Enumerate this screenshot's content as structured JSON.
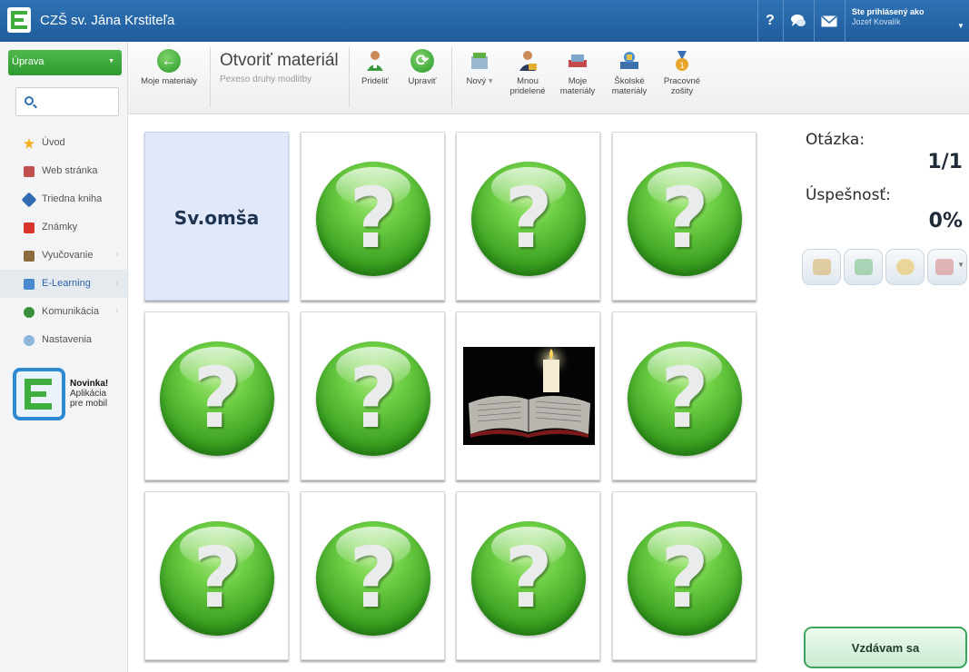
{
  "app": {
    "title": "CZŠ sv. Jána Krstiteľa"
  },
  "topbar": {
    "help_icon": "question-icon",
    "chat_icon": "chat-icon",
    "mail_icon": "mail-icon",
    "user_label": "Ste prihlásený ako",
    "user_name": "Jozef Kovalík"
  },
  "sidebar": {
    "mode_label": "Úprava",
    "search_placeholder": "",
    "items": [
      {
        "label": "Úvod",
        "icon": "star-icon",
        "color": "#f0b020"
      },
      {
        "label": "Web stránka",
        "icon": "website-icon",
        "color": "#c0504d"
      },
      {
        "label": "Triedna kniha",
        "icon": "book-icon",
        "color": "#2f6db0"
      },
      {
        "label": "Známky",
        "icon": "grades-icon",
        "color": "#d9342b"
      },
      {
        "label": "Vyučovanie",
        "icon": "teaching-icon",
        "color": "#8a6d3b"
      },
      {
        "label": "E-Learning",
        "icon": "elearning-icon",
        "color": "#4a8bd0"
      },
      {
        "label": "Komunikácia",
        "icon": "communication-icon",
        "color": "#3a8f3a"
      },
      {
        "label": "Nastavenia",
        "icon": "settings-icon",
        "color": "#8fb7dd"
      }
    ],
    "promo": {
      "title": "Novinka!",
      "line1": "Aplikácia",
      "line2": "pre mobil"
    }
  },
  "toolbar": {
    "back_label": "Moje materiály",
    "open_title": "Otvoriť materiál",
    "open_subtitle": "Pexeso druhy modlitby",
    "assign_label": "Prideliť",
    "edit_label": "Upraviť",
    "new_label": "Nový",
    "assigned_by_me_line1": "Mnou",
    "assigned_by_me_line2": "pridelené",
    "my_materials_line1": "Moje",
    "my_materials_line2": "materiály",
    "school_materials_line1": "Školské",
    "school_materials_line2": "materiály",
    "workbooks_line1": "Pracovné",
    "workbooks_line2": "zošity"
  },
  "board": {
    "cards": [
      {
        "state": "text",
        "text": "Sv.omša"
      },
      {
        "state": "hidden"
      },
      {
        "state": "hidden"
      },
      {
        "state": "hidden"
      },
      {
        "state": "hidden"
      },
      {
        "state": "hidden"
      },
      {
        "state": "image",
        "image": "candle-and-bible"
      },
      {
        "state": "hidden"
      },
      {
        "state": "hidden"
      },
      {
        "state": "hidden"
      },
      {
        "state": "hidden"
      },
      {
        "state": "hidden"
      }
    ],
    "hidden_glyph": "?"
  },
  "panel": {
    "question_label": "Otázka:",
    "question_value": "1/1",
    "success_label": "Úspešnosť:",
    "success_value": "0%",
    "give_up_label": "Vzdávam sa"
  },
  "colors": {
    "topbar": "#2a6aad",
    "accent_green": "#3aa020",
    "revealed_card": "#e0e8fa"
  }
}
